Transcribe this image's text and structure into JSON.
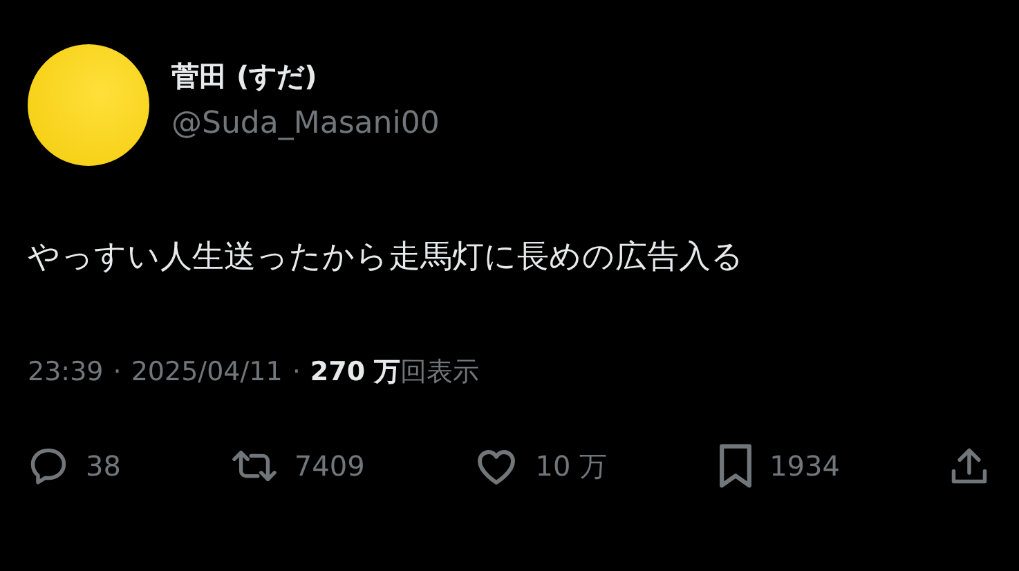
{
  "author": {
    "name": "菅田 (すだ)",
    "handle": "@Suda_Masani00"
  },
  "text": "やっすい人生送ったから走馬灯に長めの広告入る",
  "meta": {
    "time": "23:39",
    "separator_1": "·",
    "date": "2025/04/11",
    "separator_2": "·",
    "views": "**270 万**回表示"
  },
  "actions": [
    {
      "kind": "reply",
      "count": "38"
    },
    {
      "kind": "repost",
      "count": "7409"
    },
    {
      "kind": "like",
      "count": "10 万"
    },
    {
      "kind": "bookmark",
      "count": "1934"
    },
    {
      "kind": "share"
    }
  ]
}
